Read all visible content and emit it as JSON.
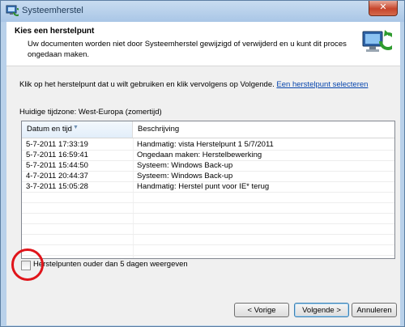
{
  "window": {
    "title": "Systeemherstel",
    "close_glyph": "✕"
  },
  "header": {
    "title": "Kies een herstelpunt",
    "description": "Uw documenten worden niet door Systeemherstel gewijzigd of verwijderd en u kunt dit proces ongedaan maken."
  },
  "instruction": {
    "text": "Klik op het herstelpunt dat u wilt gebruiken en klik vervolgens op Volgende.",
    "link": "Een herstelpunt selecteren"
  },
  "timezone": "Huidige tijdzone: West-Europa (zomertijd)",
  "table": {
    "columns": [
      "Datum en tijd",
      "Beschrijving"
    ],
    "rows": [
      {
        "datetime": "5-7-2011 17:33:19",
        "description": "Handmatig: vista Herstelpunt 1  5/7/2011"
      },
      {
        "datetime": "5-7-2011 16:59:41",
        "description": "Ongedaan maken: Herstelbewerking"
      },
      {
        "datetime": "5-7-2011 15:44:50",
        "description": "Systeem: Windows Back-up"
      },
      {
        "datetime": "4-7-2011 20:44:37",
        "description": "Systeem: Windows Back-up"
      },
      {
        "datetime": "3-7-2011 15:05:28",
        "description": "Handmatig: Herstel punt voor IE* terug"
      }
    ]
  },
  "checkbox": {
    "label": "Herstelpunten ouder dan 5 dagen weergeven",
    "checked": false
  },
  "buttons": {
    "prev": "< Vorige",
    "next": "Volgende >",
    "cancel": "Annuleren"
  },
  "colors": {
    "link": "#0645ad",
    "annotation": "#e0141a"
  }
}
